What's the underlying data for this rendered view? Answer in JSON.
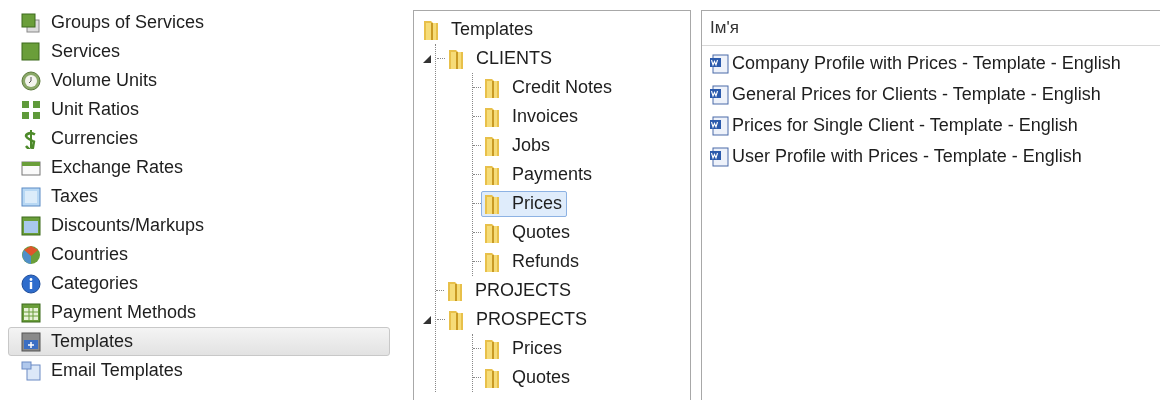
{
  "sidebar": {
    "items": [
      {
        "label": "Groups of Services",
        "selected": false
      },
      {
        "label": "Services",
        "selected": false
      },
      {
        "label": "Volume Units",
        "selected": false
      },
      {
        "label": "Unit Ratios",
        "selected": false
      },
      {
        "label": "Currencies",
        "selected": false
      },
      {
        "label": "Exchange Rates",
        "selected": false
      },
      {
        "label": "Taxes",
        "selected": false
      },
      {
        "label": "Discounts/Markups",
        "selected": false
      },
      {
        "label": "Countries",
        "selected": false
      },
      {
        "label": "Categories",
        "selected": false
      },
      {
        "label": "Payment Methods",
        "selected": false
      },
      {
        "label": "Templates",
        "selected": true
      },
      {
        "label": "Email Templates",
        "selected": false
      }
    ]
  },
  "tree": {
    "root": {
      "label": "Templates",
      "selected": false,
      "children": [
        {
          "label": "CLIENTS",
          "selected": false,
          "expanded": true,
          "children": [
            {
              "label": "Credit Notes",
              "selected": false
            },
            {
              "label": "Invoices",
              "selected": false
            },
            {
              "label": "Jobs",
              "selected": false
            },
            {
              "label": "Payments",
              "selected": false
            },
            {
              "label": "Prices",
              "selected": true
            },
            {
              "label": "Quotes",
              "selected": false
            },
            {
              "label": "Refunds",
              "selected": false
            }
          ]
        },
        {
          "label": "PROJECTS",
          "selected": false,
          "expanded": false
        },
        {
          "label": "PROSPECTS",
          "selected": false,
          "expanded": true,
          "children": [
            {
              "label": "Prices",
              "selected": false
            },
            {
              "label": "Quotes",
              "selected": false
            }
          ]
        }
      ]
    }
  },
  "file_list": {
    "columns": [
      "Ім'я"
    ],
    "rows": [
      {
        "name": "Company Profile with Prices - Template - English"
      },
      {
        "name": "General Prices for Clients - Template - English"
      },
      {
        "name": "Prices for Single Client - Template - English"
      },
      {
        "name": "User Profile with Prices - Template - English"
      }
    ]
  }
}
